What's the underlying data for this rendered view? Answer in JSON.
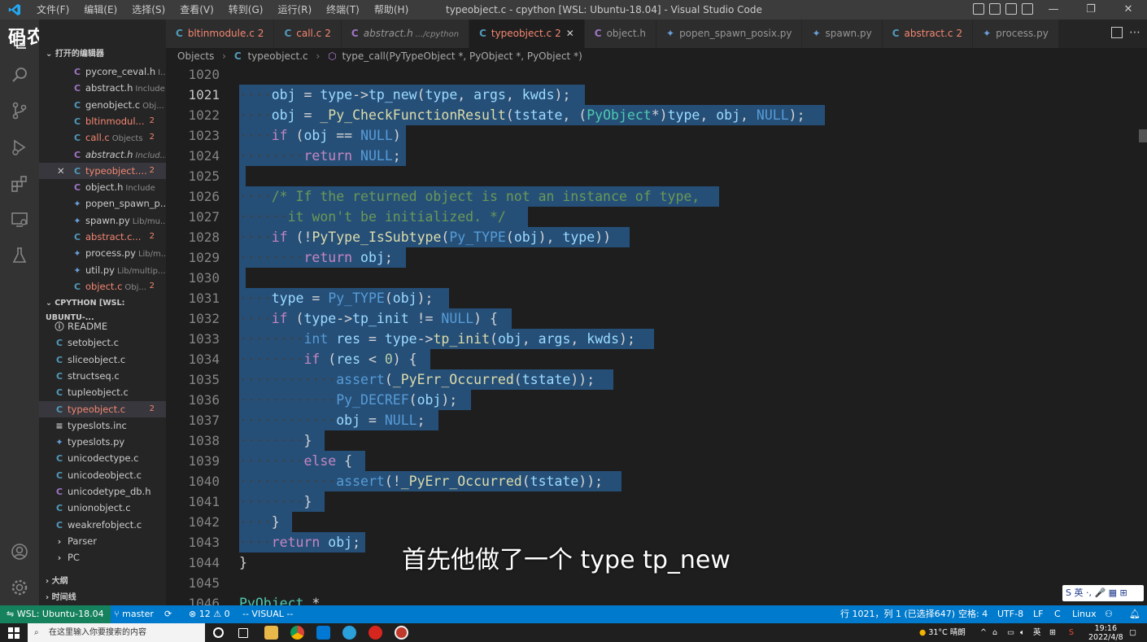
{
  "window": {
    "title": "typeobject.c - cpython [WSL: Ubuntu-18.04] - Visual Studio Code",
    "menus": [
      "文件(F)",
      "编辑(E)",
      "选择(S)",
      "查看(V)",
      "转到(G)",
      "运行(R)",
      "终端(T)",
      "帮助(H)"
    ],
    "controls": [
      "—",
      "❐",
      "✕"
    ]
  },
  "watermark": "码农高天",
  "watermark_logo": "bilibili",
  "tabs": [
    {
      "icon": "C",
      "label": "bltinmodule.c",
      "badge": "2",
      "error": true
    },
    {
      "icon": "C",
      "label": "call.c",
      "badge": "2",
      "error": true
    },
    {
      "icon": "C",
      "label": "abstract.h",
      "desc": ".../cpython",
      "italic": true
    },
    {
      "icon": "C",
      "label": "typeobject.c",
      "badge": "2",
      "error": true,
      "active": true,
      "close": "✕"
    },
    {
      "icon": "C",
      "label": "object.h"
    },
    {
      "icon": "py",
      "label": "popen_spawn_posix.py"
    },
    {
      "icon": "py",
      "label": "spawn.py"
    },
    {
      "icon": "C",
      "label": "abstract.c",
      "badge": "2",
      "error": true
    },
    {
      "icon": "py",
      "label": "process.py"
    }
  ],
  "breadcrumb": {
    "folder": "Objects",
    "file": "typeobject.c",
    "symbol": "type_call(PyTypeObject *, PyObject *, PyObject *)"
  },
  "sidebar": {
    "open_editors_header": "打开的编辑器",
    "open_editors": [
      {
        "icon": "C",
        "type": "h",
        "name": "pycore_ceval.h",
        "desc": "I..."
      },
      {
        "icon": "C",
        "type": "h",
        "name": "abstract.h",
        "desc": "Include"
      },
      {
        "icon": "C",
        "type": "c",
        "name": "genobject.c",
        "desc": "Obj..."
      },
      {
        "icon": "C",
        "type": "c",
        "name": "bltinmodul...",
        "badge": "2",
        "error": true
      },
      {
        "icon": "C",
        "type": "c",
        "name": "call.c",
        "desc": "Objects",
        "badge": "2",
        "error": true
      },
      {
        "icon": "C",
        "type": "h",
        "name": "abstract.h",
        "desc": "Includ...",
        "italic": true
      },
      {
        "icon": "C",
        "type": "c",
        "name": "typeobject....",
        "badge": "2",
        "error": true,
        "selected": true,
        "close": "✕"
      },
      {
        "icon": "C",
        "type": "h",
        "name": "object.h",
        "desc": "Include"
      },
      {
        "icon": "py",
        "type": "py",
        "name": "popen_spawn_p..."
      },
      {
        "icon": "py",
        "type": "py",
        "name": "spawn.py",
        "desc": "Lib/mu..."
      },
      {
        "icon": "C",
        "type": "c",
        "name": "abstract.c...",
        "badge": "2",
        "error": true
      },
      {
        "icon": "py",
        "type": "py",
        "name": "process.py",
        "desc": "Lib/m..."
      },
      {
        "icon": "py",
        "type": "py",
        "name": "util.py",
        "desc": "Lib/multip..."
      },
      {
        "icon": "C",
        "type": "c",
        "name": "object.c",
        "desc": "Obj...",
        "badge": "2",
        "error": true
      }
    ],
    "workspace_header": "CPYTHON [WSL: UBUNTU-...",
    "workspace_items": [
      {
        "icon": "ⓘ",
        "type": "i",
        "name": "README"
      },
      {
        "icon": "C",
        "type": "c",
        "name": "setobject.c"
      },
      {
        "icon": "C",
        "type": "c",
        "name": "sliceobject.c"
      },
      {
        "icon": "C",
        "type": "c",
        "name": "structseq.c"
      },
      {
        "icon": "C",
        "type": "c",
        "name": "tupleobject.c"
      },
      {
        "icon": "C",
        "type": "c",
        "name": "typeobject.c",
        "badge": "2",
        "error": true,
        "selected": true
      },
      {
        "icon": "≡",
        "type": "i",
        "name": "typeslots.inc"
      },
      {
        "icon": "py",
        "type": "py",
        "name": "typeslots.py"
      },
      {
        "icon": "C",
        "type": "c",
        "name": "unicodectype.c"
      },
      {
        "icon": "C",
        "type": "c",
        "name": "unicodeobject.c"
      },
      {
        "icon": "C",
        "type": "h",
        "name": "unicodetype_db.h"
      },
      {
        "icon": "C",
        "type": "c",
        "name": "unionobject.c"
      },
      {
        "icon": "C",
        "type": "c",
        "name": "weakrefobject.c"
      },
      {
        "icon": "›",
        "type": "folder",
        "name": "Parser"
      },
      {
        "icon": "›",
        "type": "folder",
        "name": "PC"
      }
    ],
    "outline_header": "大纲",
    "timeline_header": "时间线"
  },
  "editor": {
    "lines": [
      {
        "n": "1020",
        "html": ""
      },
      {
        "n": "1021",
        "cur": true,
        "html": "<span class='ind'>····</span><span class='var'>obj</span> = <span class='var'>type</span>-><span class='var'>tp_new</span>(<span class='var'>type</span>, <span class='var'>args</span>, <span class='var'>kwds</span>);"
      },
      {
        "n": "1022",
        "html": "<span class='ind'>····</span><span class='var'>obj</span> = <span class='fn'>_Py_CheckFunctionResult</span>(<span class='var'>tstate</span>, (<span class='ty'>PyObject</span>*)<span class='var'>type</span>, <span class='var'>obj</span>, <span class='mac'>NULL</span>);"
      },
      {
        "n": "1023",
        "html": "<span class='ind'>····</span><span class='kw2'>if</span> (<span class='var'>obj</span> == <span class='mac'>NULL</span>)"
      },
      {
        "n": "1024",
        "html": "<span class='ind'>········</span><span class='kw2'>return</span> <span class='mac'>NULL</span>;"
      },
      {
        "n": "1025",
        "html": ""
      },
      {
        "n": "1026",
        "html": "<span class='ind'>····</span><span class='cm'>/* If the returned object is not an instance of type,</span>"
      },
      {
        "n": "1027",
        "html": "<span class='ind'>······</span><span class='cm'>it won't be initialized. */</span>"
      },
      {
        "n": "1028",
        "html": "<span class='ind'>····</span><span class='kw2'>if</span> (!<span class='fn'>PyType_IsSubtype</span>(<span class='mac'>Py_TYPE</span>(<span class='var'>obj</span>), <span class='var'>type</span>))"
      },
      {
        "n": "1029",
        "html": "<span class='ind'>········</span><span class='kw2'>return</span> <span class='var'>obj</span>;"
      },
      {
        "n": "1030",
        "html": ""
      },
      {
        "n": "1031",
        "html": "<span class='ind'>····</span><span class='var'>type</span> = <span class='mac'>Py_TYPE</span>(<span class='var'>obj</span>);"
      },
      {
        "n": "1032",
        "html": "<span class='ind'>····</span><span class='kw2'>if</span> (<span class='var'>type</span>-><span class='var'>tp_init</span> != <span class='mac'>NULL</span>) {"
      },
      {
        "n": "1033",
        "html": "<span class='ind'>········</span><span class='kw'>int</span> <span class='var'>res</span> = <span class='var'>type</span>-><span class='fn'>tp_init</span>(<span class='var'>obj</span>, <span class='var'>args</span>, <span class='var'>kwds</span>);"
      },
      {
        "n": "1034",
        "html": "<span class='ind'>········</span><span class='kw2'>if</span> (<span class='var'>res</span> < <span class='num'>0</span>) {"
      },
      {
        "n": "1035",
        "html": "<span class='ind'>············</span><span class='mac'>assert</span>(<span class='fn'>_PyErr_Occurred</span>(<span class='var'>tstate</span>));"
      },
      {
        "n": "1036",
        "html": "<span class='ind'>············</span><span class='mac'>Py_DECREF</span>(<span class='var'>obj</span>);"
      },
      {
        "n": "1037",
        "html": "<span class='ind'>············</span><span class='var'>obj</span> = <span class='mac'>NULL</span>;"
      },
      {
        "n": "1038",
        "html": "<span class='ind'>········</span>}"
      },
      {
        "n": "1039",
        "html": "<span class='ind'>········</span><span class='kw2'>else</span> {"
      },
      {
        "n": "1040",
        "html": "<span class='ind'>············</span><span class='mac'>assert</span>(!<span class='fn'>_PyErr_Occurred</span>(<span class='var'>tstate</span>));"
      },
      {
        "n": "1041",
        "html": "<span class='ind'>········</span>}"
      },
      {
        "n": "1042",
        "html": "<span class='ind'>····</span>}"
      },
      {
        "n": "1043",
        "html": "<span class='ind'>····</span><span class='kw2'>return</span> <span class='var'>obj</span>;"
      },
      {
        "n": "1044",
        "html": "}"
      },
      {
        "n": "1045",
        "html": ""
      },
      {
        "n": "1046",
        "html": "<span class='ty'>PyObject</span> *"
      }
    ]
  },
  "subtitle": "首先他做了一个 type tp_new",
  "statusbar": {
    "remote": "WSL: Ubuntu-18.04",
    "branch": "master",
    "sync": "⟳",
    "problems": "⊗ 12 ⚠ 0",
    "mode": "-- VISUAL --",
    "position": "行 1021，列 1 (已选择647)",
    "spaces": "空格: 4",
    "encoding": "UTF-8",
    "eol": "LF",
    "language": "C",
    "os": "Linux"
  },
  "taskbar": {
    "search_placeholder": "在这里输入你要搜索的内容",
    "weather": "31°C 晴朗",
    "ime": "英",
    "time": "19:16",
    "date": "2022/4/8"
  },
  "ime_bar": "S 英 ·, 🎤 ▦ ⊞",
  "colors": {
    "selection": "#264f78",
    "status_bar": "#007acc",
    "error": "#f48771"
  }
}
